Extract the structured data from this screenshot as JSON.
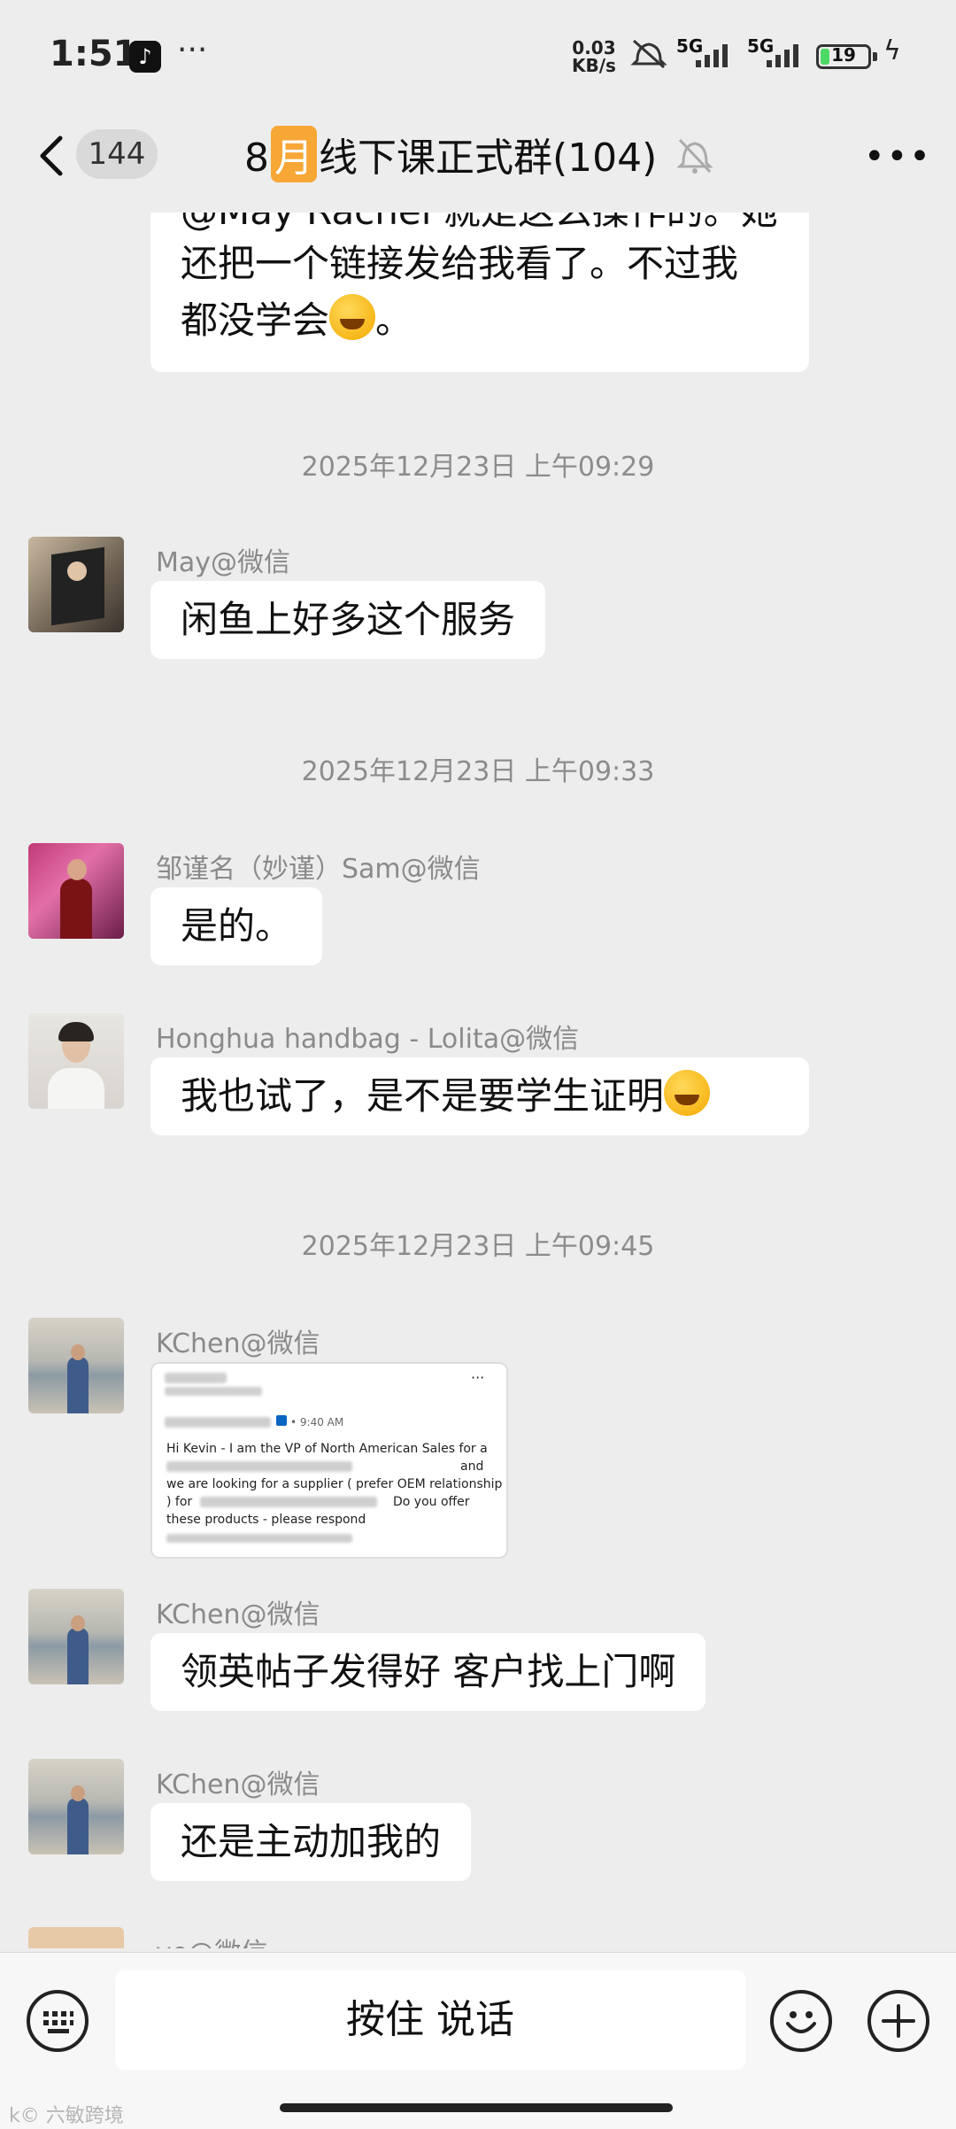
{
  "status": {
    "time": "1:51",
    "speed_value": "0.03",
    "speed_unit": "KB/s",
    "net1": "5G",
    "net2": "5G",
    "battery": "19",
    "battery_level_percent": 19
  },
  "nav": {
    "unread": "144",
    "title_pre": "8",
    "title_hl": "月",
    "title_post": "线下课正式群(104)"
  },
  "colors": {
    "bg": "#ededed",
    "bubble": "#ffffff",
    "title_highlight": "#f7a736",
    "battery": "#4cd964"
  },
  "messages": {
    "top_partial_line": "@May Rachel 就是这么操作的。她",
    "top_line2": "还把一个链接发给我看了。不过我",
    "top_line3": "都没学会",
    "top_line3_end": "。",
    "ts1": "2025年12月23日 上午09:29",
    "m1_sender": "May@微信",
    "m1_text": "闲鱼上好多这个服务",
    "ts2": "2025年12月23日 上午09:33",
    "m2_sender": "邹谨名（妙谨）Sam@微信",
    "m2_text": "是的。",
    "m3_sender": "Honghua handbag - Lolita@微信",
    "m3_text": "我也试了，是不是要学生证明",
    "ts3": "2025年12月23日 上午09:45",
    "m4_sender": "KChen@微信",
    "m4_img_time": "• 9:40 AM",
    "m4_img_l1": "Hi Kevin - I am the VP of North American Sales for a",
    "m4_img_l2": "and",
    "m4_img_l3": "we are looking for a supplier ( prefer OEM relationship",
    "m4_img_l4a": ") for",
    "m4_img_l4b": "Do you offer",
    "m4_img_l5": "these products - please respond",
    "m5_sender": "KChen@微信",
    "m5_text": "领英帖子发得好 客户找上门啊",
    "m6_sender": "KChen@微信",
    "m6_text": "还是主动加我的",
    "m7_sender_partial": "ye@微信"
  },
  "bottom": {
    "talk": "按住 说话",
    "watermark": "k© 六敏跨境"
  }
}
